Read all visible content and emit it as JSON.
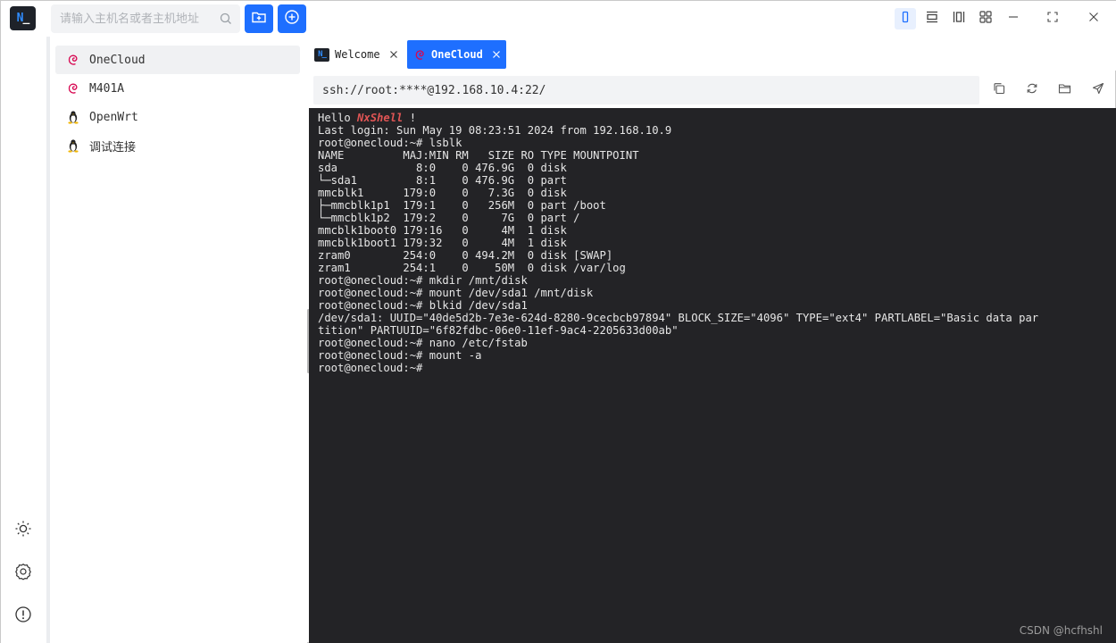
{
  "app": {
    "logo_text": "N",
    "logo_underscore": "_"
  },
  "toolbar": {
    "search_placeholder": "请输入主机名或者主机地址",
    "search_value": ""
  },
  "sidebar": {
    "hosts": [
      {
        "label": "OneCloud",
        "icon": "debian-icon",
        "selected": true
      },
      {
        "label": "M401A",
        "icon": "debian-icon",
        "selected": false
      },
      {
        "label": "OpenWrt",
        "icon": "linux-tux-icon",
        "selected": false
      },
      {
        "label": "调试连接",
        "icon": "linux-tux-icon",
        "selected": false
      }
    ]
  },
  "tabs": [
    {
      "label": "Welcome",
      "active": false
    },
    {
      "label": "OneCloud",
      "active": true
    }
  ],
  "address": {
    "value": "ssh://root:****@192.168.10.4:22/"
  },
  "terminal": {
    "hello_prefix": "Hello ",
    "hello_brand": "NxShell",
    "hello_suffix": " !",
    "lines": [
      "Last login: Sun May 19 08:23:51 2024 from 192.168.10.9",
      "root@onecloud:~# lsblk",
      "NAME         MAJ:MIN RM   SIZE RO TYPE MOUNTPOINT",
      "sda            8:0    0 476.9G  0 disk",
      "└─sda1         8:1    0 476.9G  0 part",
      "mmcblk1      179:0    0   7.3G  0 disk",
      "├─mmcblk1p1  179:1    0   256M  0 part /boot",
      "└─mmcblk1p2  179:2    0     7G  0 part /",
      "mmcblk1boot0 179:16   0     4M  1 disk",
      "mmcblk1boot1 179:32   0     4M  1 disk",
      "zram0        254:0    0 494.2M  0 disk [SWAP]",
      "zram1        254:1    0    50M  0 disk /var/log",
      "root@onecloud:~# mkdir /mnt/disk",
      "root@onecloud:~# mount /dev/sda1 /mnt/disk",
      "root@onecloud:~# blkid /dev/sda1",
      "/dev/sda1: UUID=\"40de5d2b-7e3e-624d-8280-9cecbcb97894\" BLOCK_SIZE=\"4096\" TYPE=\"ext4\" PARTLABEL=\"Basic data par",
      "tition\" PARTUUID=\"6f82fdbc-06e0-11ef-9ac4-2205633d00ab\"",
      "root@onecloud:~# nano /etc/fstab",
      "root@onecloud:~# mount -a",
      "root@onecloud:~# "
    ]
  },
  "watermark": "CSDN @hcfhshl",
  "colors": {
    "accent": "#1e6fff",
    "terminal_bg": "#232326",
    "terminal_fg": "#e6e6e6",
    "brand_red": "#e05555",
    "debian_red": "#d70751"
  }
}
